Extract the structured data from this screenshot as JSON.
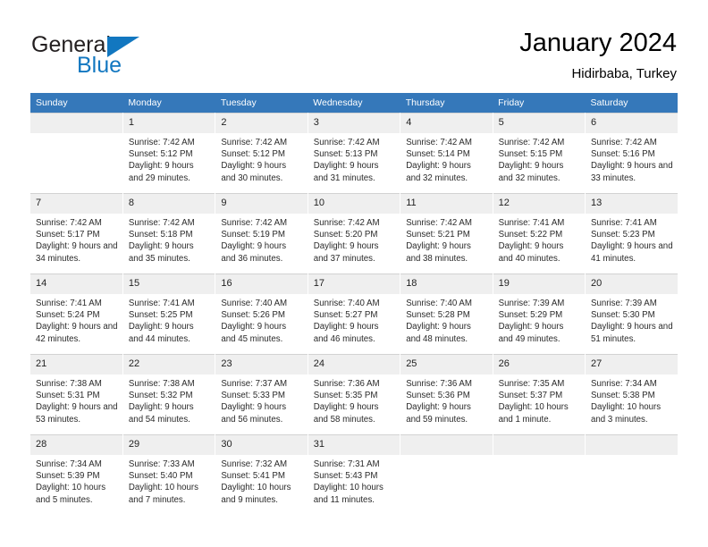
{
  "brand": {
    "name_top": "General",
    "name_bottom": "Blue",
    "accent_color": "#1277c0",
    "triangle_icon": "triangle-icon"
  },
  "header": {
    "title": "January 2024",
    "subtitle": "Hidirbaba, Turkey"
  },
  "theme": {
    "header_row_bg": "#3578ba",
    "daynum_bg": "#efefef",
    "cell_border": "#d2d2d2",
    "text": "#000000"
  },
  "calendar": {
    "weekday_headers": [
      "Sunday",
      "Monday",
      "Tuesday",
      "Wednesday",
      "Thursday",
      "Friday",
      "Saturday"
    ],
    "weeks": [
      [
        {
          "day": "",
          "blank": true,
          "sunrise": "",
          "sunset": "",
          "daylight": ""
        },
        {
          "day": "1",
          "sunrise": "Sunrise: 7:42 AM",
          "sunset": "Sunset: 5:12 PM",
          "daylight": "Daylight: 9 hours and 29 minutes."
        },
        {
          "day": "2",
          "sunrise": "Sunrise: 7:42 AM",
          "sunset": "Sunset: 5:12 PM",
          "daylight": "Daylight: 9 hours and 30 minutes."
        },
        {
          "day": "3",
          "sunrise": "Sunrise: 7:42 AM",
          "sunset": "Sunset: 5:13 PM",
          "daylight": "Daylight: 9 hours and 31 minutes."
        },
        {
          "day": "4",
          "sunrise": "Sunrise: 7:42 AM",
          "sunset": "Sunset: 5:14 PM",
          "daylight": "Daylight: 9 hours and 32 minutes."
        },
        {
          "day": "5",
          "sunrise": "Sunrise: 7:42 AM",
          "sunset": "Sunset: 5:15 PM",
          "daylight": "Daylight: 9 hours and 32 minutes."
        },
        {
          "day": "6",
          "sunrise": "Sunrise: 7:42 AM",
          "sunset": "Sunset: 5:16 PM",
          "daylight": "Daylight: 9 hours and 33 minutes."
        }
      ],
      [
        {
          "day": "7",
          "sunrise": "Sunrise: 7:42 AM",
          "sunset": "Sunset: 5:17 PM",
          "daylight": "Daylight: 9 hours and 34 minutes."
        },
        {
          "day": "8",
          "sunrise": "Sunrise: 7:42 AM",
          "sunset": "Sunset: 5:18 PM",
          "daylight": "Daylight: 9 hours and 35 minutes."
        },
        {
          "day": "9",
          "sunrise": "Sunrise: 7:42 AM",
          "sunset": "Sunset: 5:19 PM",
          "daylight": "Daylight: 9 hours and 36 minutes."
        },
        {
          "day": "10",
          "sunrise": "Sunrise: 7:42 AM",
          "sunset": "Sunset: 5:20 PM",
          "daylight": "Daylight: 9 hours and 37 minutes."
        },
        {
          "day": "11",
          "sunrise": "Sunrise: 7:42 AM",
          "sunset": "Sunset: 5:21 PM",
          "daylight": "Daylight: 9 hours and 38 minutes."
        },
        {
          "day": "12",
          "sunrise": "Sunrise: 7:41 AM",
          "sunset": "Sunset: 5:22 PM",
          "daylight": "Daylight: 9 hours and 40 minutes."
        },
        {
          "day": "13",
          "sunrise": "Sunrise: 7:41 AM",
          "sunset": "Sunset: 5:23 PM",
          "daylight": "Daylight: 9 hours and 41 minutes."
        }
      ],
      [
        {
          "day": "14",
          "sunrise": "Sunrise: 7:41 AM",
          "sunset": "Sunset: 5:24 PM",
          "daylight": "Daylight: 9 hours and 42 minutes."
        },
        {
          "day": "15",
          "sunrise": "Sunrise: 7:41 AM",
          "sunset": "Sunset: 5:25 PM",
          "daylight": "Daylight: 9 hours and 44 minutes."
        },
        {
          "day": "16",
          "sunrise": "Sunrise: 7:40 AM",
          "sunset": "Sunset: 5:26 PM",
          "daylight": "Daylight: 9 hours and 45 minutes."
        },
        {
          "day": "17",
          "sunrise": "Sunrise: 7:40 AM",
          "sunset": "Sunset: 5:27 PM",
          "daylight": "Daylight: 9 hours and 46 minutes."
        },
        {
          "day": "18",
          "sunrise": "Sunrise: 7:40 AM",
          "sunset": "Sunset: 5:28 PM",
          "daylight": "Daylight: 9 hours and 48 minutes."
        },
        {
          "day": "19",
          "sunrise": "Sunrise: 7:39 AM",
          "sunset": "Sunset: 5:29 PM",
          "daylight": "Daylight: 9 hours and 49 minutes."
        },
        {
          "day": "20",
          "sunrise": "Sunrise: 7:39 AM",
          "sunset": "Sunset: 5:30 PM",
          "daylight": "Daylight: 9 hours and 51 minutes."
        }
      ],
      [
        {
          "day": "21",
          "sunrise": "Sunrise: 7:38 AM",
          "sunset": "Sunset: 5:31 PM",
          "daylight": "Daylight: 9 hours and 53 minutes."
        },
        {
          "day": "22",
          "sunrise": "Sunrise: 7:38 AM",
          "sunset": "Sunset: 5:32 PM",
          "daylight": "Daylight: 9 hours and 54 minutes."
        },
        {
          "day": "23",
          "sunrise": "Sunrise: 7:37 AM",
          "sunset": "Sunset: 5:33 PM",
          "daylight": "Daylight: 9 hours and 56 minutes."
        },
        {
          "day": "24",
          "sunrise": "Sunrise: 7:36 AM",
          "sunset": "Sunset: 5:35 PM",
          "daylight": "Daylight: 9 hours and 58 minutes."
        },
        {
          "day": "25",
          "sunrise": "Sunrise: 7:36 AM",
          "sunset": "Sunset: 5:36 PM",
          "daylight": "Daylight: 9 hours and 59 minutes."
        },
        {
          "day": "26",
          "sunrise": "Sunrise: 7:35 AM",
          "sunset": "Sunset: 5:37 PM",
          "daylight": "Daylight: 10 hours and 1 minute."
        },
        {
          "day": "27",
          "sunrise": "Sunrise: 7:34 AM",
          "sunset": "Sunset: 5:38 PM",
          "daylight": "Daylight: 10 hours and 3 minutes."
        }
      ],
      [
        {
          "day": "28",
          "sunrise": "Sunrise: 7:34 AM",
          "sunset": "Sunset: 5:39 PM",
          "daylight": "Daylight: 10 hours and 5 minutes."
        },
        {
          "day": "29",
          "sunrise": "Sunrise: 7:33 AM",
          "sunset": "Sunset: 5:40 PM",
          "daylight": "Daylight: 10 hours and 7 minutes."
        },
        {
          "day": "30",
          "sunrise": "Sunrise: 7:32 AM",
          "sunset": "Sunset: 5:41 PM",
          "daylight": "Daylight: 10 hours and 9 minutes."
        },
        {
          "day": "31",
          "sunrise": "Sunrise: 7:31 AM",
          "sunset": "Sunset: 5:43 PM",
          "daylight": "Daylight: 10 hours and 11 minutes."
        },
        {
          "day": "",
          "blank": true,
          "sunrise": "",
          "sunset": "",
          "daylight": ""
        },
        {
          "day": "",
          "blank": true,
          "sunrise": "",
          "sunset": "",
          "daylight": ""
        },
        {
          "day": "",
          "blank": true,
          "sunrise": "",
          "sunset": "",
          "daylight": ""
        }
      ]
    ]
  }
}
